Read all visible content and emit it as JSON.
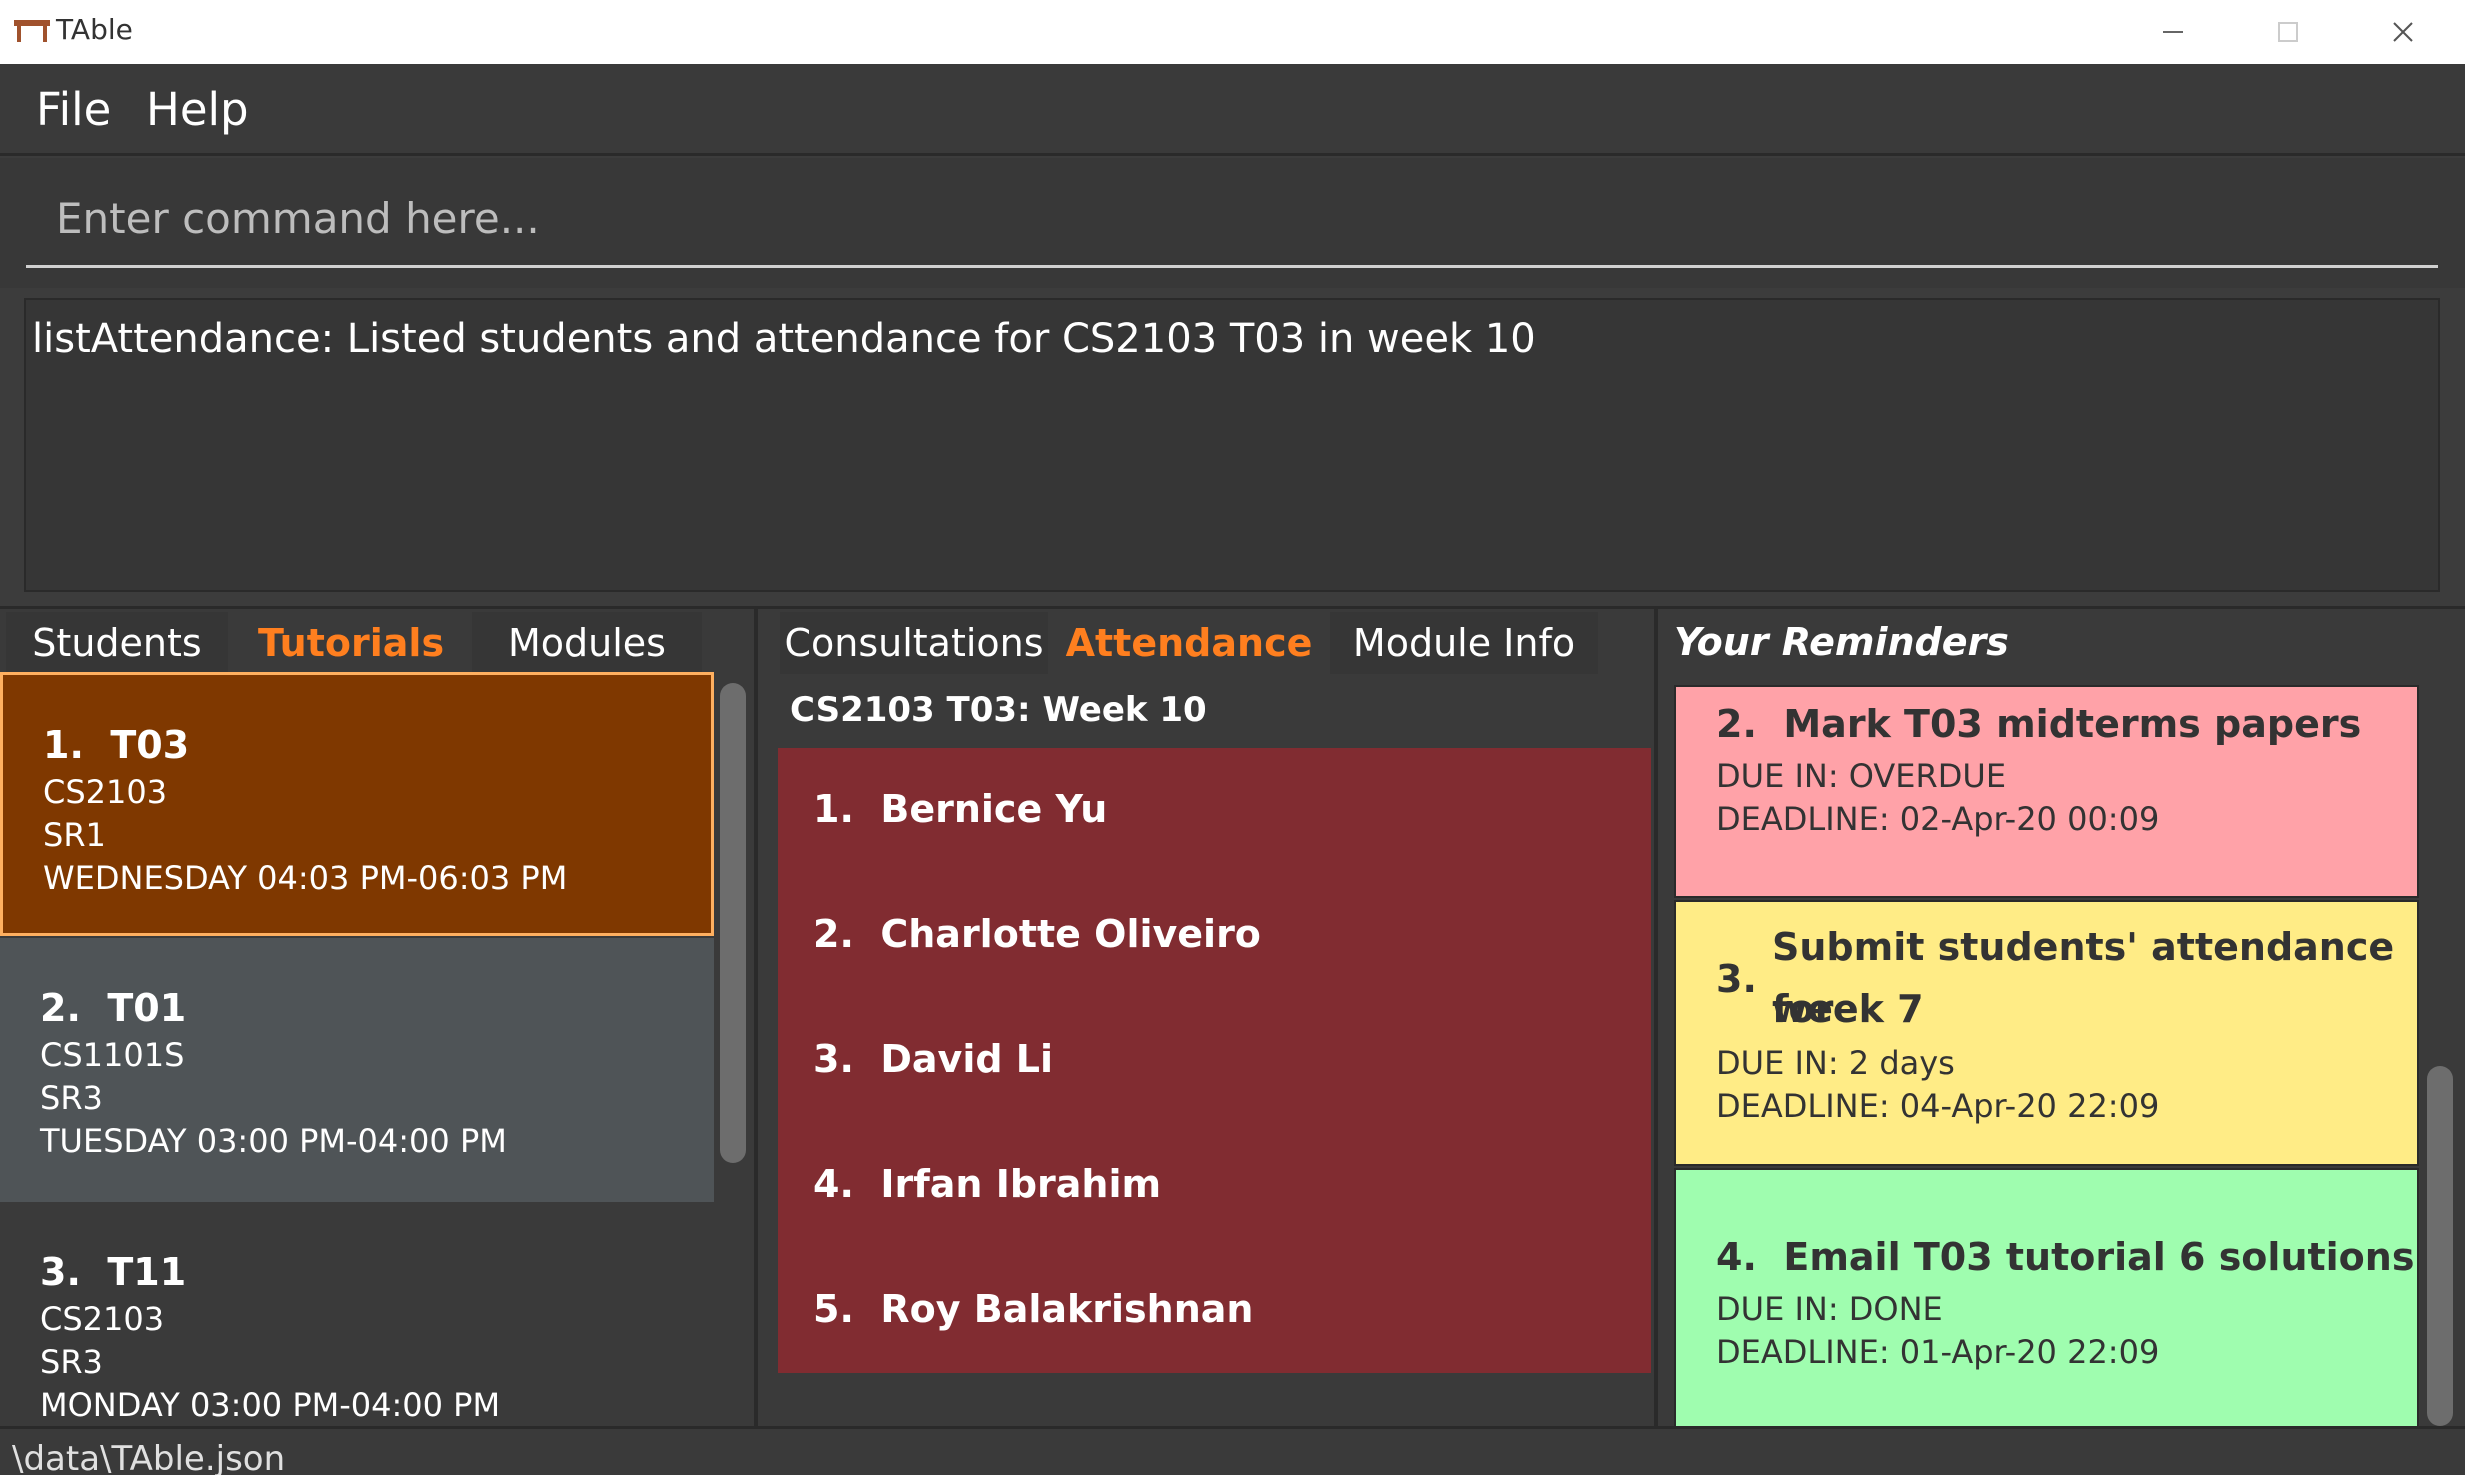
{
  "window": {
    "title": "TAble",
    "app_icon": "table-icon",
    "minimize_icon": "minimize-icon",
    "maximize_icon": "maximize-icon",
    "close_icon": "close-icon"
  },
  "menu": {
    "file": "File",
    "help": "Help"
  },
  "command": {
    "placeholder": "Enter command here...",
    "value": ""
  },
  "result": {
    "text": "listAttendance: Listed students and attendance for CS2103 T03 in week 10"
  },
  "left_tabs": [
    {
      "label": "Students",
      "active": false
    },
    {
      "label": "Tutorials",
      "active": true
    },
    {
      "label": "Modules",
      "active": false
    }
  ],
  "tutorials": [
    {
      "index": "1.",
      "name": "T03",
      "module": "CS2103",
      "venue": "SR1",
      "time": "WEDNESDAY 04:03 PM-06:03 PM",
      "selected": true
    },
    {
      "index": "2.",
      "name": "T01",
      "module": "CS1101S",
      "venue": "SR3",
      "time": "TUESDAY 03:00 PM-04:00 PM",
      "selected": false
    },
    {
      "index": "3.",
      "name": "T11",
      "module": "CS2103",
      "venue": "SR3",
      "time": "MONDAY 03:00 PM-04:00 PM",
      "selected": false
    }
  ],
  "middle_tabs": [
    {
      "label": "Consultations",
      "active": false
    },
    {
      "label": "Attendance",
      "active": true
    },
    {
      "label": "Module Info",
      "active": false
    }
  ],
  "attendance": {
    "title": "CS2103 T03: Week 10",
    "students": [
      {
        "index": "1.",
        "name": "Bernice Yu"
      },
      {
        "index": "2.",
        "name": "Charlotte Oliveiro"
      },
      {
        "index": "3.",
        "name": "David Li"
      },
      {
        "index": "4.",
        "name": "Irfan Ibrahim"
      },
      {
        "index": "5.",
        "name": "Roy Balakrishnan"
      }
    ],
    "box_color": "#812c31"
  },
  "reminders": {
    "heading": "Your Reminders",
    "items": [
      {
        "index": "2.",
        "title": "Mark T03 midterms papers",
        "due": "DUE IN: OVERDUE",
        "deadline": "DEADLINE: 02-Apr-20 00:09",
        "color": "#ffa2a8"
      },
      {
        "index": "3.",
        "title_line1": "Submit students' attendance for",
        "title_line2": "week 7",
        "due": "DUE IN: 2 days",
        "deadline": "DEADLINE: 04-Apr-20 22:09",
        "color": "#ffec86"
      },
      {
        "index": "4.",
        "title": "Email T03 tutorial 6 solutions",
        "due": "DUE IN: DONE",
        "deadline": "DEADLINE: 01-Apr-20 22:09",
        "color": "#9ffdaf"
      }
    ]
  },
  "status": {
    "path": "\\data\\TAble.json"
  },
  "colors": {
    "accent": "#ff7f1f",
    "selected_card": "#7f3800",
    "background": "#3a3a3a"
  }
}
